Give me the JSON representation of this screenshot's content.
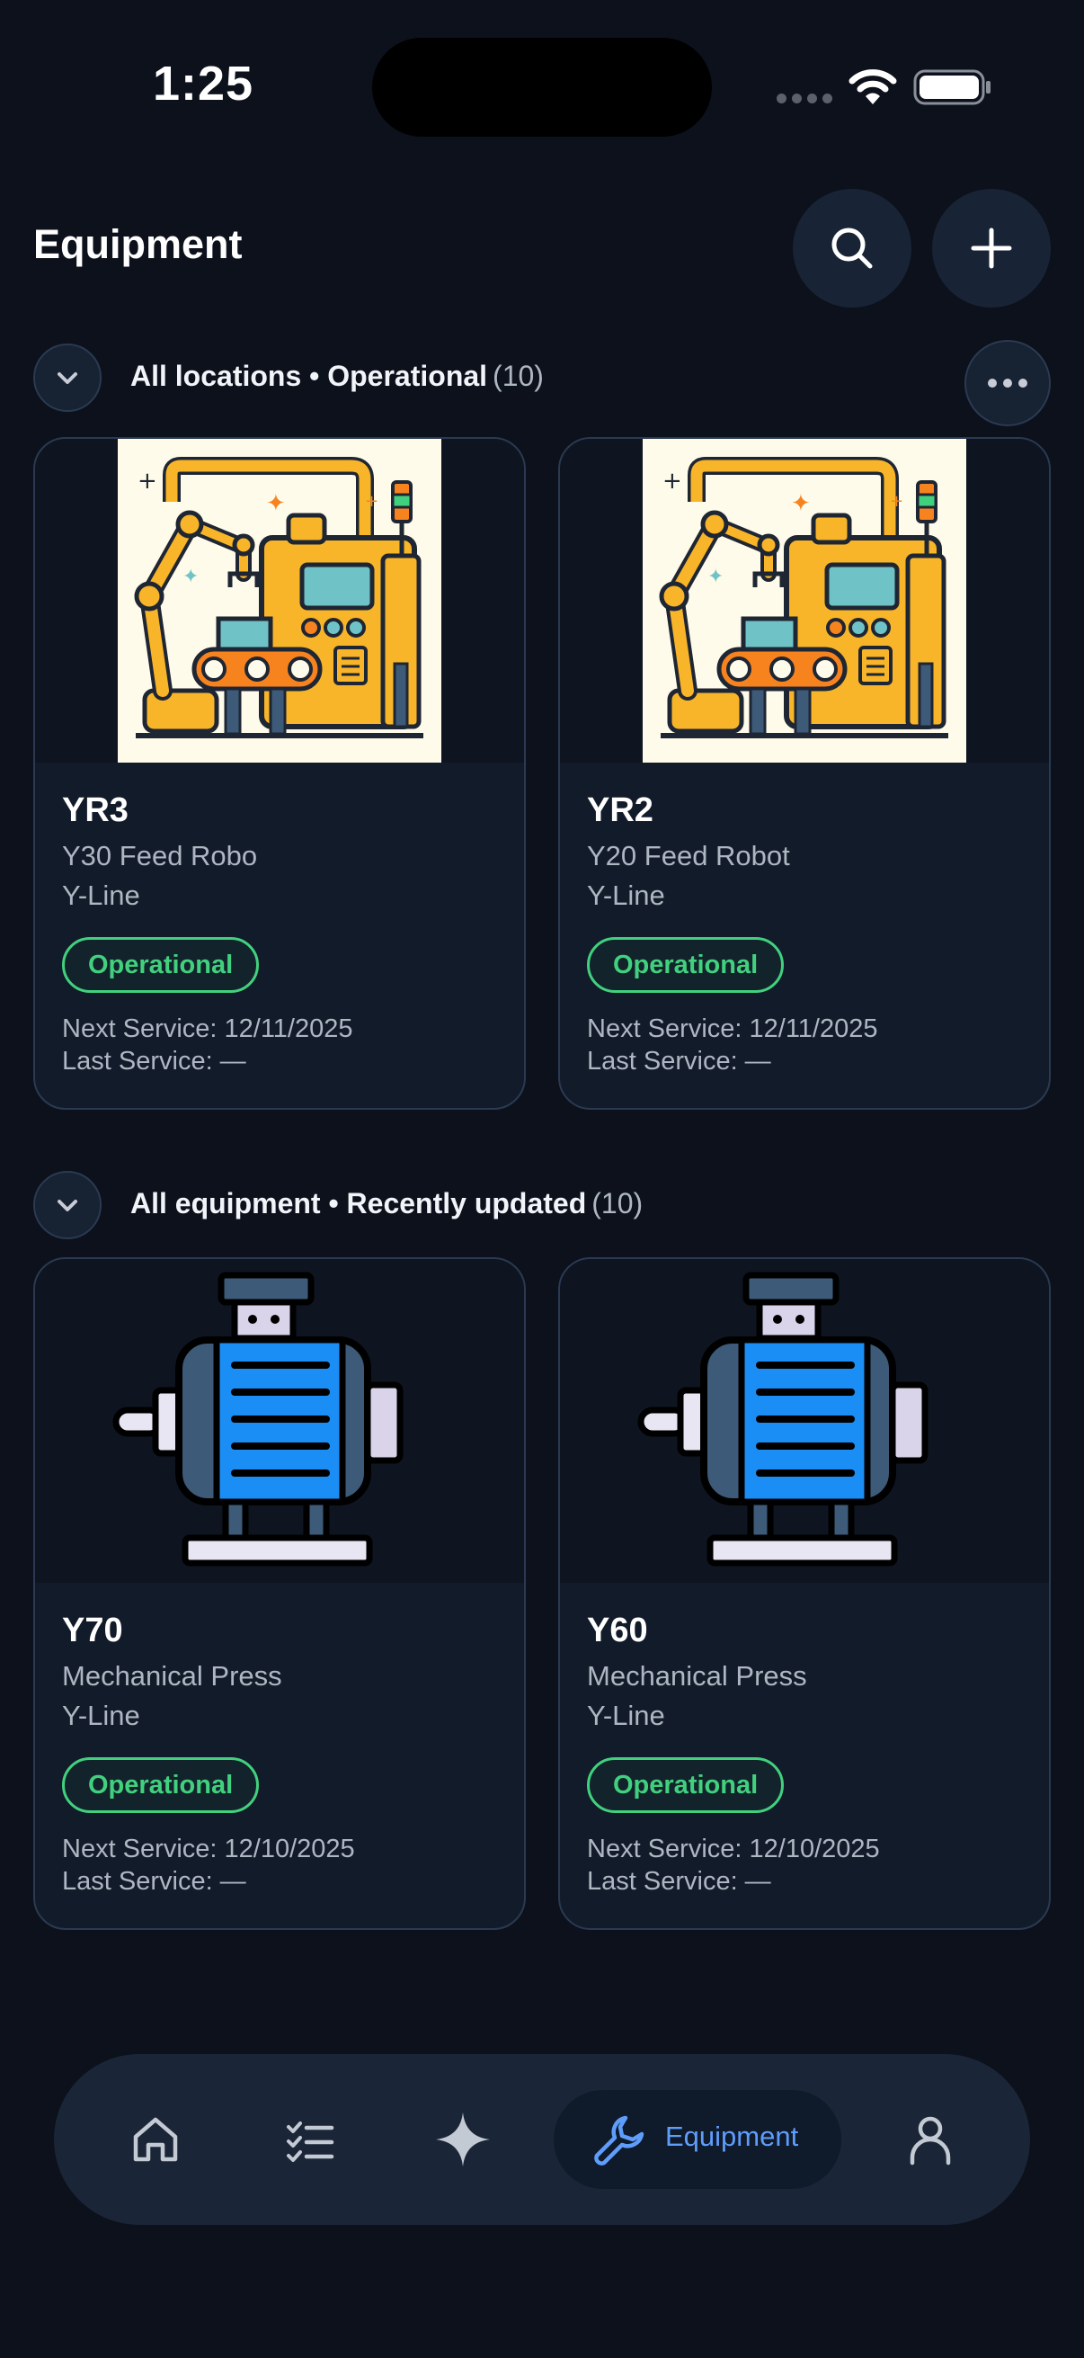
{
  "status_bar": {
    "time": "1:25"
  },
  "header": {
    "title": "Equipment"
  },
  "sections": [
    {
      "label": "All locations • Operational",
      "count": "(10)",
      "cards": [
        {
          "id": "YR3",
          "name": "Y30 Feed Robo",
          "line": "Y-Line",
          "status": "Operational",
          "next_service": "Next Service: 12/11/2025",
          "last_service": "Last Service: —",
          "image_icon": "robot-arm-icon"
        },
        {
          "id": "YR2",
          "name": "Y20 Feed Robot",
          "line": "Y-Line",
          "status": "Operational",
          "next_service": "Next Service: 12/11/2025",
          "last_service": "Last Service: —",
          "image_icon": "robot-arm-icon"
        }
      ]
    },
    {
      "label": "All equipment • Recently updated",
      "count": "(10)",
      "cards": [
        {
          "id": "Y70",
          "name": "Mechanical Press",
          "line": "Y-Line",
          "status": "Operational",
          "next_service": "Next Service: 12/10/2025",
          "last_service": "Last Service: —",
          "image_icon": "electric-motor-icon"
        },
        {
          "id": "Y60",
          "name": "Mechanical Press",
          "line": "Y-Line",
          "status": "Operational",
          "next_service": "Next Service: 12/10/2025",
          "last_service": "Last Service: —",
          "image_icon": "electric-motor-icon"
        }
      ]
    }
  ],
  "bottom_nav": {
    "items": [
      {
        "icon": "home-icon"
      },
      {
        "icon": "checklist-icon"
      },
      {
        "icon": "sparkle-icon"
      },
      {
        "icon": "wrench-icon",
        "label": "Equipment",
        "active": true
      },
      {
        "icon": "profile-icon"
      }
    ]
  },
  "colors": {
    "background": "#0c111b",
    "card": "#121b29",
    "status_green": "#41d17e",
    "accent_blue": "#5f9dfb"
  }
}
